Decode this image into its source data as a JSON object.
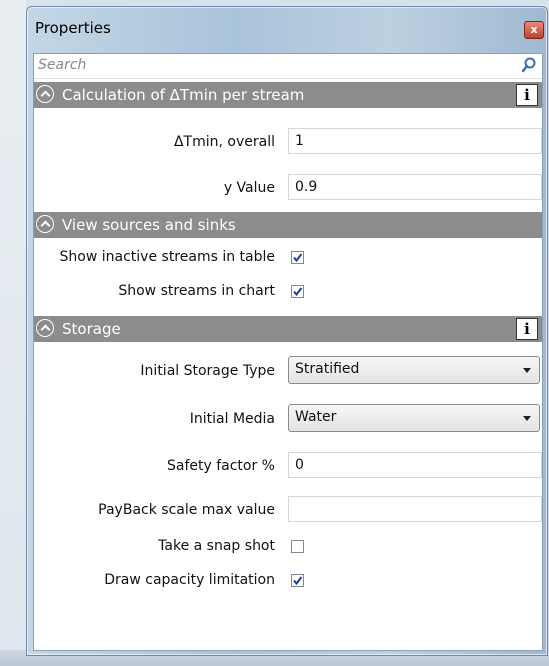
{
  "window": {
    "title": "Properties",
    "close_label": "x"
  },
  "search": {
    "placeholder": "Search"
  },
  "sections": {
    "dtmin": {
      "title": "Calculation of ΔTmin per stream",
      "overall_label": "ΔTmin, overall",
      "overall_value": "1",
      "y_label": "y Value",
      "y_value": "0.9"
    },
    "sources": {
      "title": "View sources and sinks",
      "inactive_label": "Show inactive streams in table",
      "inactive_checked": true,
      "chart_label": "Show streams in chart",
      "chart_checked": true
    },
    "storage": {
      "title": "Storage",
      "type_label": "Initial Storage Type",
      "type_value": "Stratified",
      "media_label": "Initial Media",
      "media_value": "Water",
      "safety_label": "Safety factor %",
      "safety_value": "0",
      "payback_label": "PayBack scale max value",
      "payback_value": "",
      "snapshot_label": "Take a snap shot",
      "snapshot_checked": false,
      "capacity_label": "Draw capacity limitation",
      "capacity_checked": true
    }
  },
  "icons": {
    "collapse": "chevron-up-icon",
    "info": "info-icon",
    "search": "search-icon",
    "close": "close-icon"
  },
  "colors": {
    "section_header": "#8c8c8c",
    "window_frame": "#a9c3da"
  }
}
